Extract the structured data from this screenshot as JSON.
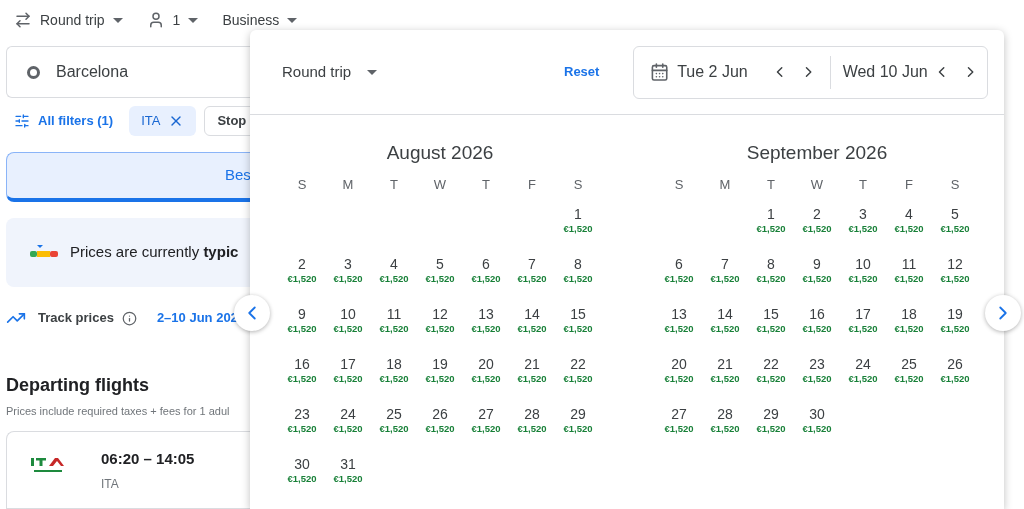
{
  "top_bar": {
    "trip_type": "Round trip",
    "passengers": "1",
    "cabin": "Business"
  },
  "search": {
    "origin": "Barcelona"
  },
  "filters": {
    "all_filters": "All filters (1)",
    "chips": [
      {
        "label": "ITA",
        "selected": true
      },
      {
        "label": "Stop",
        "selected": false
      }
    ]
  },
  "tabs": [
    {
      "label": "Bes",
      "selected": true
    }
  ],
  "price_insight": {
    "text": "Prices are currently **typic**"
  },
  "track": {
    "label": "Track prices",
    "dates": "2–10 Jun 202"
  },
  "departing": {
    "title": "Departing flights",
    "subtitle": "Prices include required taxes + fees for 1 adul",
    "flights": [
      {
        "times": "06:20 – 14:05",
        "airline": "ITA"
      }
    ]
  },
  "date_picker": {
    "trip_type": "Round trip",
    "reset": "Reset",
    "departure": "Tue 2 Jun",
    "return": "Wed 10 Jun",
    "months": [
      {
        "title": "August 2026",
        "weekdays": [
          "S",
          "M",
          "T",
          "W",
          "T",
          "F",
          "S"
        ],
        "weeks": [
          [
            {
              "day": "1",
              "price": "€1,520"
            }
          ],
          [
            {
              "day": "2",
              "price": "€1,520"
            },
            {
              "day": "3",
              "price": "€1,520"
            },
            {
              "day": "4",
              "price": "€1,520"
            },
            {
              "day": "5",
              "price": "€1,520"
            },
            {
              "day": "6",
              "price": "€1,520"
            },
            {
              "day": "7",
              "price": "€1,520"
            },
            {
              "day": "8",
              "price": "€1,520"
            }
          ],
          [
            {
              "day": "9",
              "price": "€1,520"
            },
            {
              "day": "10",
              "price": "€1,520"
            },
            {
              "day": "11",
              "price": "€1,520"
            },
            {
              "day": "12",
              "price": "€1,520"
            },
            {
              "day": "13",
              "price": "€1,520"
            },
            {
              "day": "14",
              "price": "€1,520"
            },
            {
              "day": "15",
              "price": "€1,520"
            }
          ],
          [
            {
              "day": "16",
              "price": "€1,520"
            },
            {
              "day": "17",
              "price": "€1,520"
            },
            {
              "day": "18",
              "price": "€1,520"
            },
            {
              "day": "19",
              "price": "€1,520"
            },
            {
              "day": "20",
              "price": "€1,520"
            },
            {
              "day": "21",
              "price": "€1,520"
            },
            {
              "day": "22",
              "price": "€1,520"
            }
          ],
          [
            {
              "day": "23",
              "price": "€1,520"
            },
            {
              "day": "24",
              "price": "€1,520"
            },
            {
              "day": "25",
              "price": "€1,520"
            },
            {
              "day": "26",
              "price": "€1,520"
            },
            {
              "day": "27",
              "price": "€1,520"
            },
            {
              "day": "28",
              "price": "€1,520"
            },
            {
              "day": "29",
              "price": "€1,520"
            }
          ],
          [
            {
              "day": "30",
              "price": "€1,520"
            },
            {
              "day": "31",
              "price": "€1,520"
            }
          ]
        ]
      },
      {
        "title": "September 2026",
        "weekdays": [
          "S",
          "M",
          "T",
          "W",
          "T",
          "F",
          "S"
        ],
        "weeks": [
          [
            {
              "day": "1",
              "price": "€1,520"
            },
            {
              "day": "2",
              "price": "€1,520"
            },
            {
              "day": "3",
              "price": "€1,520"
            },
            {
              "day": "4",
              "price": "€1,520"
            },
            {
              "day": "5",
              "price": "€1,520"
            }
          ],
          [
            {
              "day": "6",
              "price": "€1,520"
            },
            {
              "day": "7",
              "price": "€1,520"
            },
            {
              "day": "8",
              "price": "€1,520"
            },
            {
              "day": "9",
              "price": "€1,520"
            },
            {
              "day": "10",
              "price": "€1,520"
            },
            {
              "day": "11",
              "price": "€1,520"
            },
            {
              "day": "12",
              "price": "€1,520"
            }
          ],
          [
            {
              "day": "13",
              "price": "€1,520"
            },
            {
              "day": "14",
              "price": "€1,520"
            },
            {
              "day": "15",
              "price": "€1,520"
            },
            {
              "day": "16",
              "price": "€1,520"
            },
            {
              "day": "17",
              "price": "€1,520"
            },
            {
              "day": "18",
              "price": "€1,520"
            },
            {
              "day": "19",
              "price": "€1,520"
            }
          ],
          [
            {
              "day": "20",
              "price": "€1,520"
            },
            {
              "day": "21",
              "price": "€1,520"
            },
            {
              "day": "22",
              "price": "€1,520"
            },
            {
              "day": "23",
              "price": "€1,520"
            },
            {
              "day": "24",
              "price": "€1,520"
            },
            {
              "day": "25",
              "price": "€1,520"
            },
            {
              "day": "26",
              "price": "€1,520"
            }
          ],
          [
            {
              "day": "27",
              "price": "€1,520"
            },
            {
              "day": "28",
              "price": "€1,520"
            },
            {
              "day": "29",
              "price": "€1,520"
            },
            {
              "day": "30",
              "price": "€1,520"
            }
          ]
        ]
      }
    ]
  }
}
